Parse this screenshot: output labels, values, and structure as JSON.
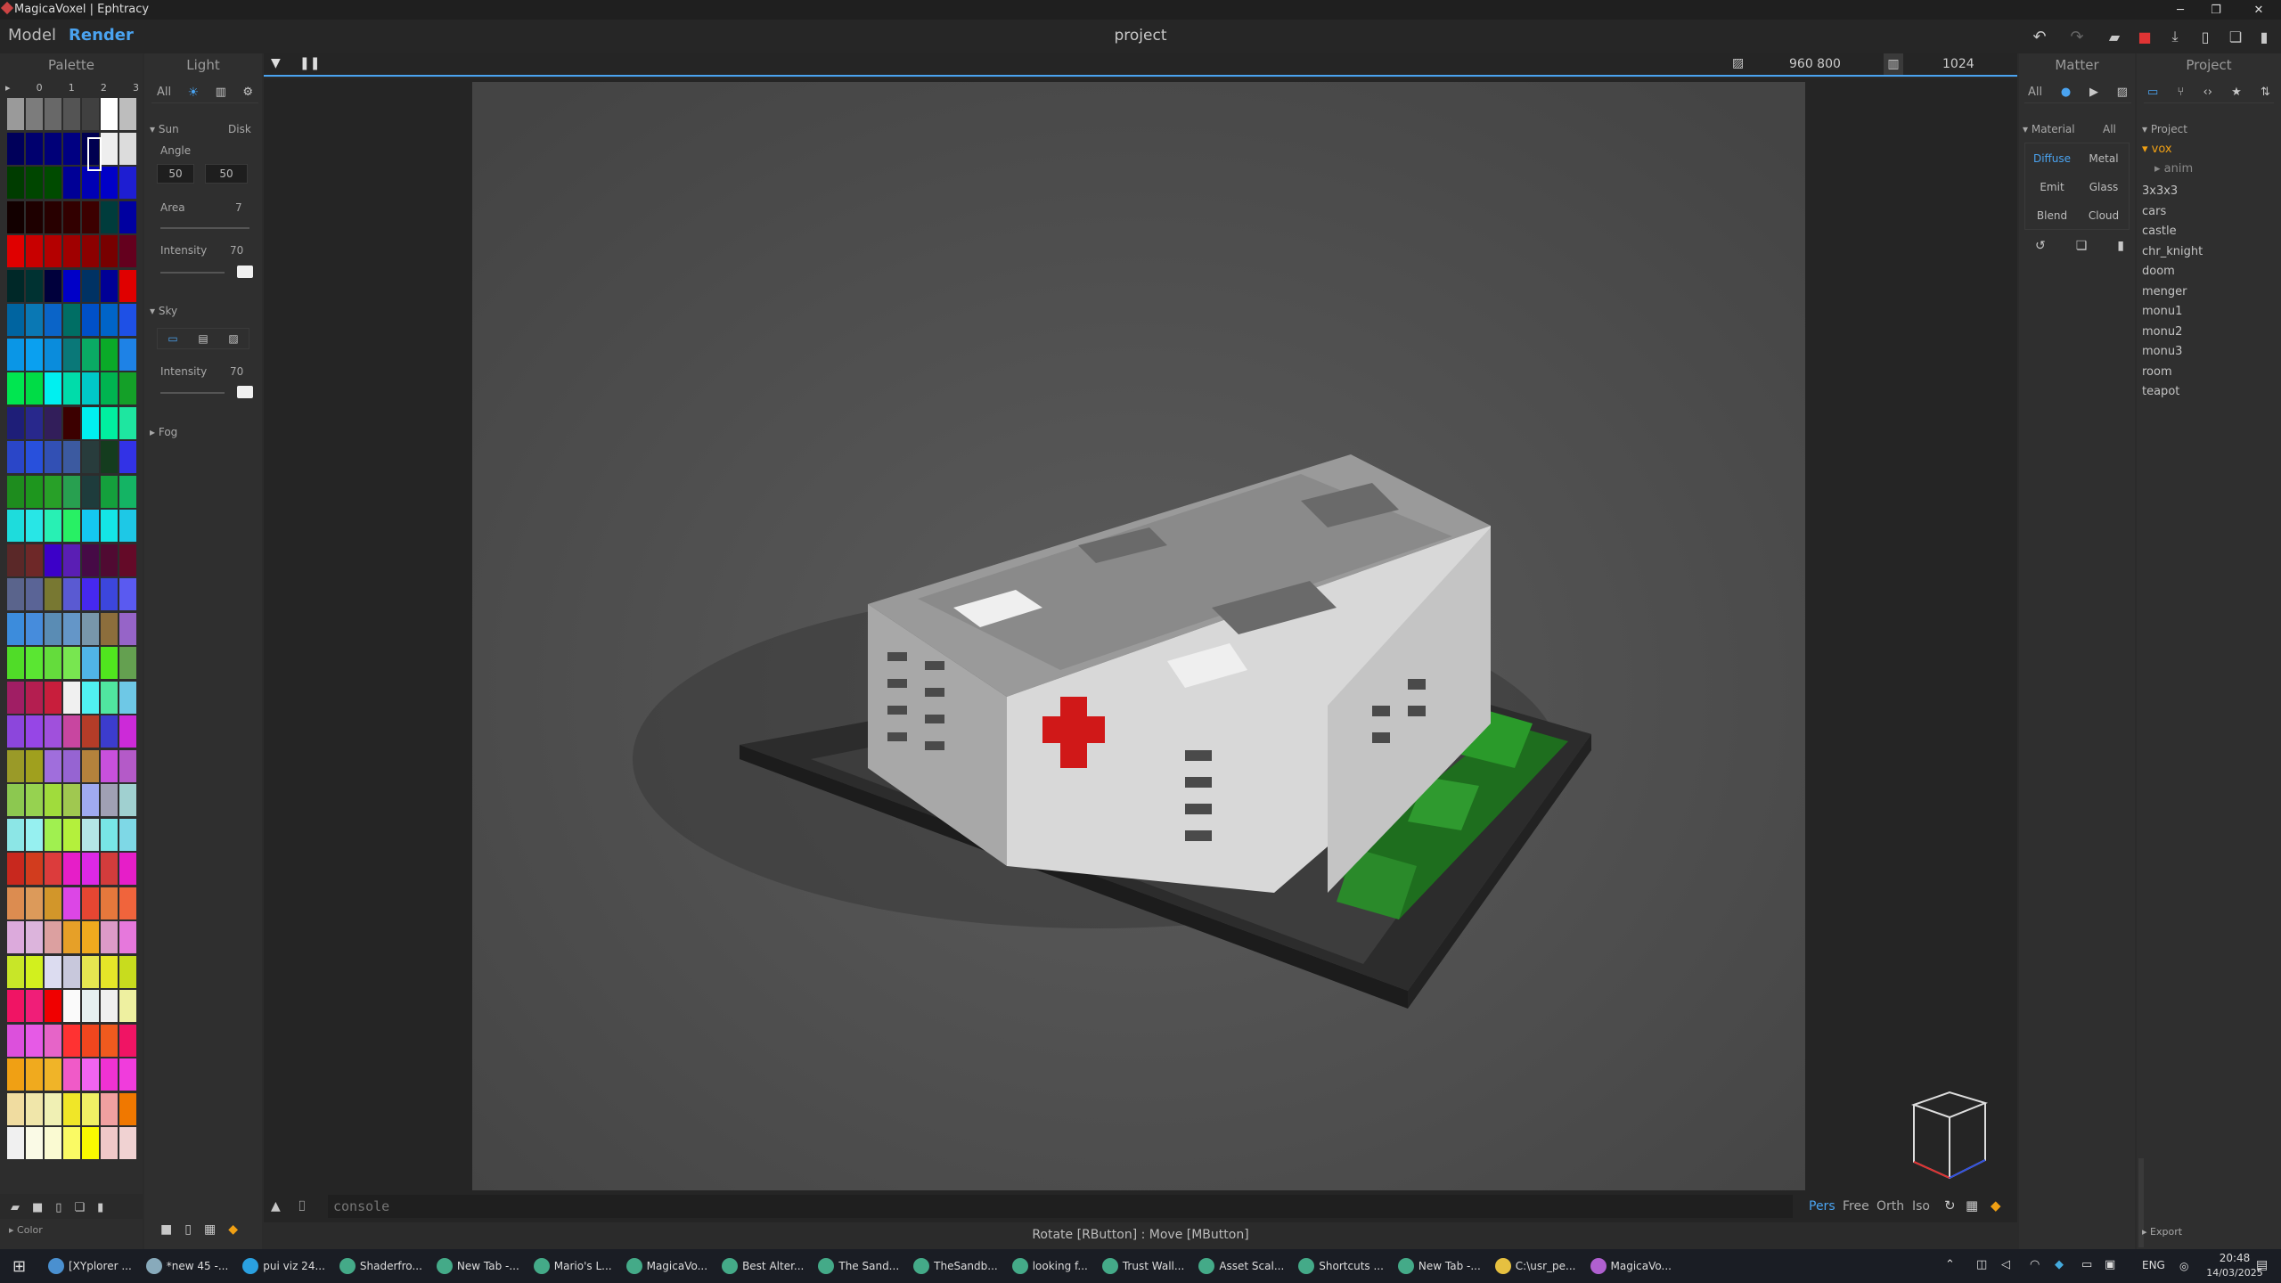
{
  "window": {
    "title": "MagicaVoxel | Ephtracy",
    "project_name": "project"
  },
  "menu": {
    "model": "Model",
    "render": "Render"
  },
  "palette": {
    "title": "Palette",
    "tabs": [
      "▸",
      "0",
      "1",
      "2",
      "3"
    ],
    "footer_label": "Color",
    "columns": [
      [
        "#9a9a9a",
        "#00005a",
        "#003c00",
        "#120000",
        "#e00000",
        "#002828",
        "#0064a0",
        "#0a96e6",
        "#00e650",
        "#1e1e78",
        "#2a46c8",
        "#1e8c1e",
        "#1edcdc",
        "#5a2828",
        "#5a648c",
        "#3c8cdc",
        "#50dc28",
        "#a01e64",
        "#8c46dc",
        "#9a9a28",
        "#8cc850",
        "#8ce6e6",
        "#c8281e",
        "#dc8c50",
        "#dcaadc",
        "#c8e628",
        "#f01464",
        "#dc50dc",
        "#f0a014",
        "#f0dca0",
        "#f0f0f0"
      ],
      [
        "#7c7c7c",
        "#00006e",
        "#004600",
        "#1e0000",
        "#c80000",
        "#003232",
        "#0a78b4",
        "#0aa0f0",
        "#00dc46",
        "#28288c",
        "#2850dc",
        "#1e961e",
        "#28e6e6",
        "#6e2828",
        "#5a6496",
        "#468cdc",
        "#5ae632",
        "#b41e50",
        "#9646e6",
        "#a0a01e",
        "#96d250",
        "#96f0f0",
        "#d23c1e",
        "#dc9a5a",
        "#dcb4dc",
        "#d2f01e",
        "#f01e78",
        "#e65ae6",
        "#f0aa1e",
        "#f0e6aa",
        "#fafae6"
      ],
      [
        "#686868",
        "#000078",
        "#004b00",
        "#280000",
        "#b40000",
        "#00003c",
        "#0a64c8",
        "#0a8cdc",
        "#00f0f0",
        "#321e5a",
        "#3250b4",
        "#28a028",
        "#28f0b4",
        "#3c00c8",
        "#787832",
        "#5a8cb4",
        "#64dc3c",
        "#c81e3c",
        "#a050dc",
        "#a06edc",
        "#a0dc3c",
        "#a0f050",
        "#dc3c3c",
        "#d2962a",
        "#dca0a0",
        "#dcdcf0",
        "#f00000",
        "#e664c8",
        "#f0b428",
        "#f0f0b4",
        "#fafad2"
      ],
      [
        "#545454",
        "#000082",
        "#000096",
        "#320000",
        "#a00000",
        "#0000c8",
        "#006e64",
        "#0a7878",
        "#00dcaa",
        "#3c0000",
        "#3c5aa0",
        "#28a050",
        "#28f064",
        "#5a1eb4",
        "#5a5ad2",
        "#6496c8",
        "#78e650",
        "#f0f0f0",
        "#c846a0",
        "#9664d2",
        "#a0c850",
        "#b4f03c",
        "#e61ec8",
        "#dc46e6",
        "#e6a028",
        "#c8c8dc",
        "#fafafa",
        "#ff3232",
        "#f05ac8",
        "#f0e628",
        "#fafa64"
      ],
      [
        "#404040",
        "#000050",
        "#0000b4",
        "#3c0000",
        "#8c0000",
        "#003264",
        "#0050c8",
        "#0aaa64",
        "#00c8c8",
        "#00f0f0",
        "#283c3c",
        "#1e3c3c",
        "#14c8f0",
        "#460a46",
        "#4628f0",
        "#7896aa",
        "#50b4e6",
        "#50f0f0",
        "#b43c28",
        "#b4823c",
        "#a0aaf0",
        "#b4e6e6",
        "#dc28e6",
        "#e64632",
        "#f0aa1e",
        "#e6e650",
        "#e6f0f0",
        "#f0461e",
        "#f064f0",
        "#f0f064",
        "#fafa00"
      ],
      [
        "#ffffff",
        "#eeeeee",
        "#0000c8",
        "#003c3c",
        "#780000",
        "#000096",
        "#0064c8",
        "#0aaa28",
        "#00b450",
        "#00f0a0",
        "#143c1e",
        "#14a03c",
        "#14e6e6",
        "#500a32",
        "#3c46dc",
        "#8c6e3c",
        "#50e61e",
        "#50e6a0",
        "#3c3ccd",
        "#c850dc",
        "#a0a0b4",
        "#78e6e6",
        "#d23c3c",
        "#e6783c",
        "#dc9ac8",
        "#e6e628",
        "#f0f0f0",
        "#f05a1e",
        "#f032d2",
        "#f0a0a0",
        "#f0c8c8"
      ],
      [
        "#bdbdbd",
        "#dcdcdc",
        "#1e1ed2",
        "#0000a0",
        "#64001e",
        "#e00000",
        "#1e50e6",
        "#1e82e6",
        "#14a028",
        "#1ee6a0",
        "#3232e6",
        "#14b464",
        "#1ec8e6",
        "#640a28",
        "#5a5af0",
        "#9664c8",
        "#64a050",
        "#6ec8e6",
        "#cc2ad8",
        "#b45ac8",
        "#a0d0d0",
        "#7ed8e6",
        "#e61ec8",
        "#f0643c",
        "#e678dc",
        "#c8dc1e",
        "#eef0a0",
        "#f01464",
        "#f03cdc",
        "#f07800",
        "#f0d2d2"
      ]
    ]
  },
  "light": {
    "title": "Light",
    "tabs": [
      "All"
    ],
    "sun": {
      "label": "Sun",
      "disk": "Disk",
      "angle_label": "Angle",
      "angle_x": "50",
      "angle_y": "50",
      "area_label": "Area",
      "area_value": "7",
      "intensity_label": "Intensity",
      "intensity_value": "70"
    },
    "sky": {
      "label": "Sky",
      "intensity_label": "Intensity",
      "intensity_value": "70"
    },
    "fog": {
      "label": "Fog"
    }
  },
  "viewport": {
    "resolution": "960  800",
    "samples": "1024",
    "console_placeholder": "console",
    "view_modes": [
      "Pers",
      "Free",
      "Orth",
      "Iso"
    ],
    "active_view": "Pers",
    "status": "Rotate [RButton] : Move [MButton]"
  },
  "matter": {
    "title": "Matter",
    "tabs": [
      "All"
    ],
    "material_label": "Material",
    "material_filter": "All",
    "materials": [
      "Diffuse",
      "Metal",
      "Emit",
      "Glass",
      "Blend",
      "Cloud"
    ],
    "active_material": "Diffuse"
  },
  "project": {
    "title": "Project",
    "section": "Project",
    "folder": "vox",
    "subfolder": "anim",
    "items": [
      "3x3x3",
      "cars",
      "castle",
      "chr_knight",
      "doom",
      "menger",
      "monu1",
      "monu2",
      "monu3",
      "room",
      "teapot"
    ],
    "export_label": "Export"
  },
  "taskbar": {
    "apps": [
      "[XYplorer ...",
      "*new 45 -...",
      "pui viz 24...",
      "Shaderfro...",
      "New Tab -...",
      "Mario's L...",
      "MagicaVo...",
      "Best Alter...",
      "The Sand...",
      "TheSandb...",
      "looking f...",
      "Trust Wall...",
      "Asset Scal...",
      "Shortcuts ...",
      "New Tab -...",
      "C:\\usr_pe...",
      "MagicaVo..."
    ],
    "lang": "ENG",
    "time": "20:48",
    "date": "14/03/2025"
  },
  "colors": {
    "accent": "#4aa3f0",
    "folder": "#f0a014",
    "bg": "#2b2b2b"
  }
}
